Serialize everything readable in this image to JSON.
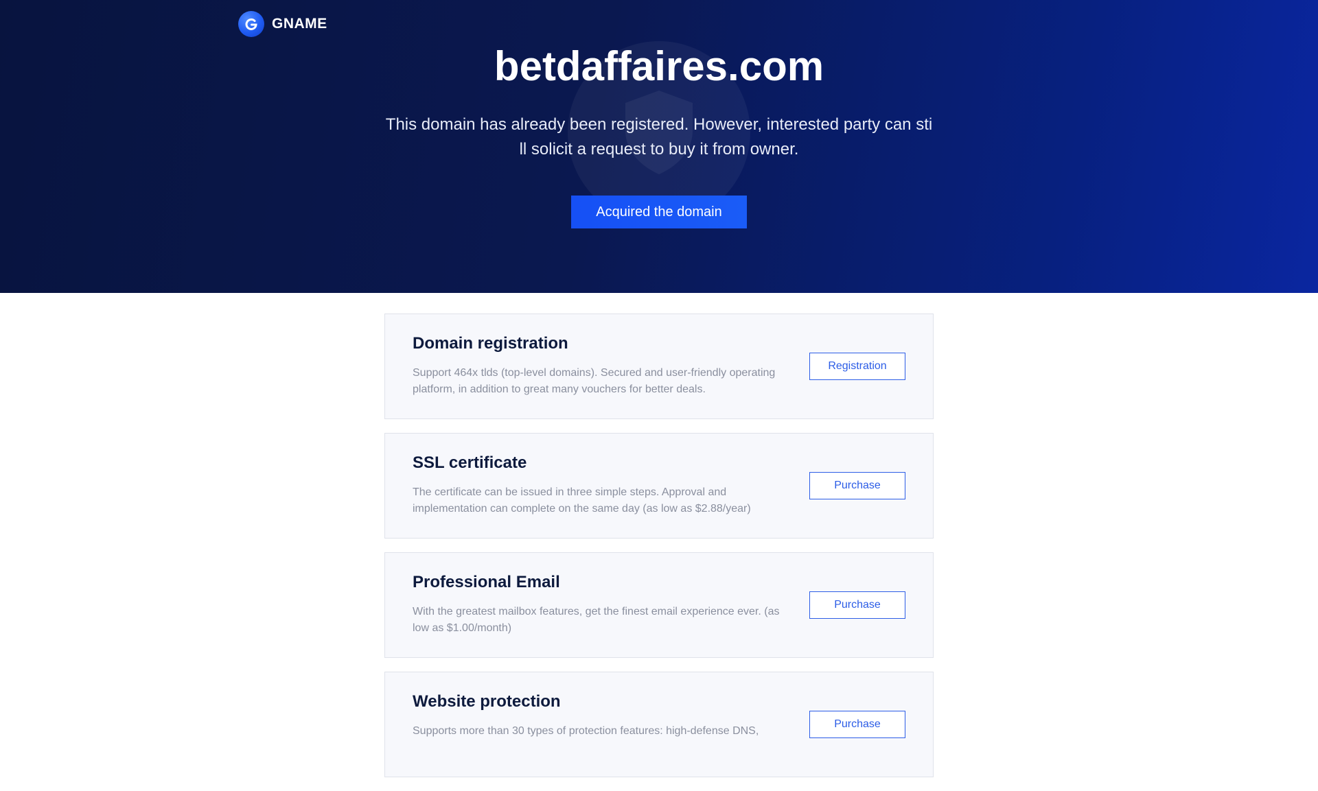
{
  "brand": {
    "name": "GNAME",
    "icon": "gname-logo-icon"
  },
  "hero": {
    "title": "betdaffaires.com",
    "subtitle": "This domain has already been registered. However, interested party can still solicit a request to buy it from owner.",
    "button_label": "Acquired the domain",
    "watermark_icon": "shield-icon"
  },
  "services": [
    {
      "title": "Domain registration",
      "description": "Support 464x tlds (top-level domains). Secured and user-friendly operating platform, in addition to great many vouchers for better deals.",
      "button_label": "Registration"
    },
    {
      "title": "SSL certificate",
      "description": "The certificate can be issued in three simple steps. Approval and implementation can complete on the same day (as low as $2.88/year)",
      "button_label": "Purchase"
    },
    {
      "title": "Professional Email",
      "description": "With the greatest mailbox features, get the finest email experience ever. (as low as $1.00/month)",
      "button_label": "Purchase"
    },
    {
      "title": "Website protection",
      "description": "Supports more than 30 types of protection features: high-defense DNS,",
      "button_label": "Purchase"
    }
  ],
  "colors": {
    "hero_dark": "#08143f",
    "hero_blue": "#0a26a0",
    "accent": "#1a5cf7",
    "outline_button": "#2b5ce6",
    "card_bg": "#f7f8fc",
    "title_text": "#0d1a3d",
    "desc_text": "#8a8f9e"
  }
}
